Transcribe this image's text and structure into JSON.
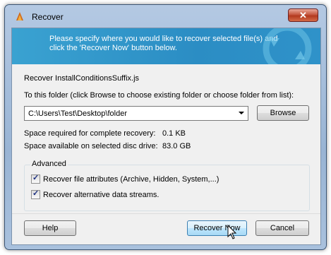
{
  "window": {
    "title": "Recover",
    "close_glyph": "✕"
  },
  "banner": {
    "text": "Please specify where you would like to recover selected file(s) and click the 'Recover Now' button below.",
    "icon": "recovery-arrows-icon"
  },
  "recover_label": "Recover InstallConditionsSuffix.js",
  "folder_prompt": "To this folder (click Browse to choose existing folder or choose folder from list):",
  "folder_path": "C:\\Users\\Test\\Desktop\\folder",
  "browse_label": "Browse",
  "space": {
    "required_label": "Space required for complete recovery:",
    "required_value": "0.1 KB",
    "available_label": "Space available on selected disc drive:",
    "available_value": "83.0 GB"
  },
  "advanced": {
    "title": "Advanced",
    "attributes_label": "Recover file attributes (Archive, Hidden, System,...)",
    "attributes_checked": true,
    "streams_label": "Recover alternative data streams.",
    "streams_checked": true
  },
  "buttons": {
    "help": "Help",
    "recover_now": "Recover Now",
    "cancel": "Cancel"
  },
  "colors": {
    "banner": "#2b8dc4",
    "close": "#c6573f",
    "frame": "#99b4d4"
  }
}
